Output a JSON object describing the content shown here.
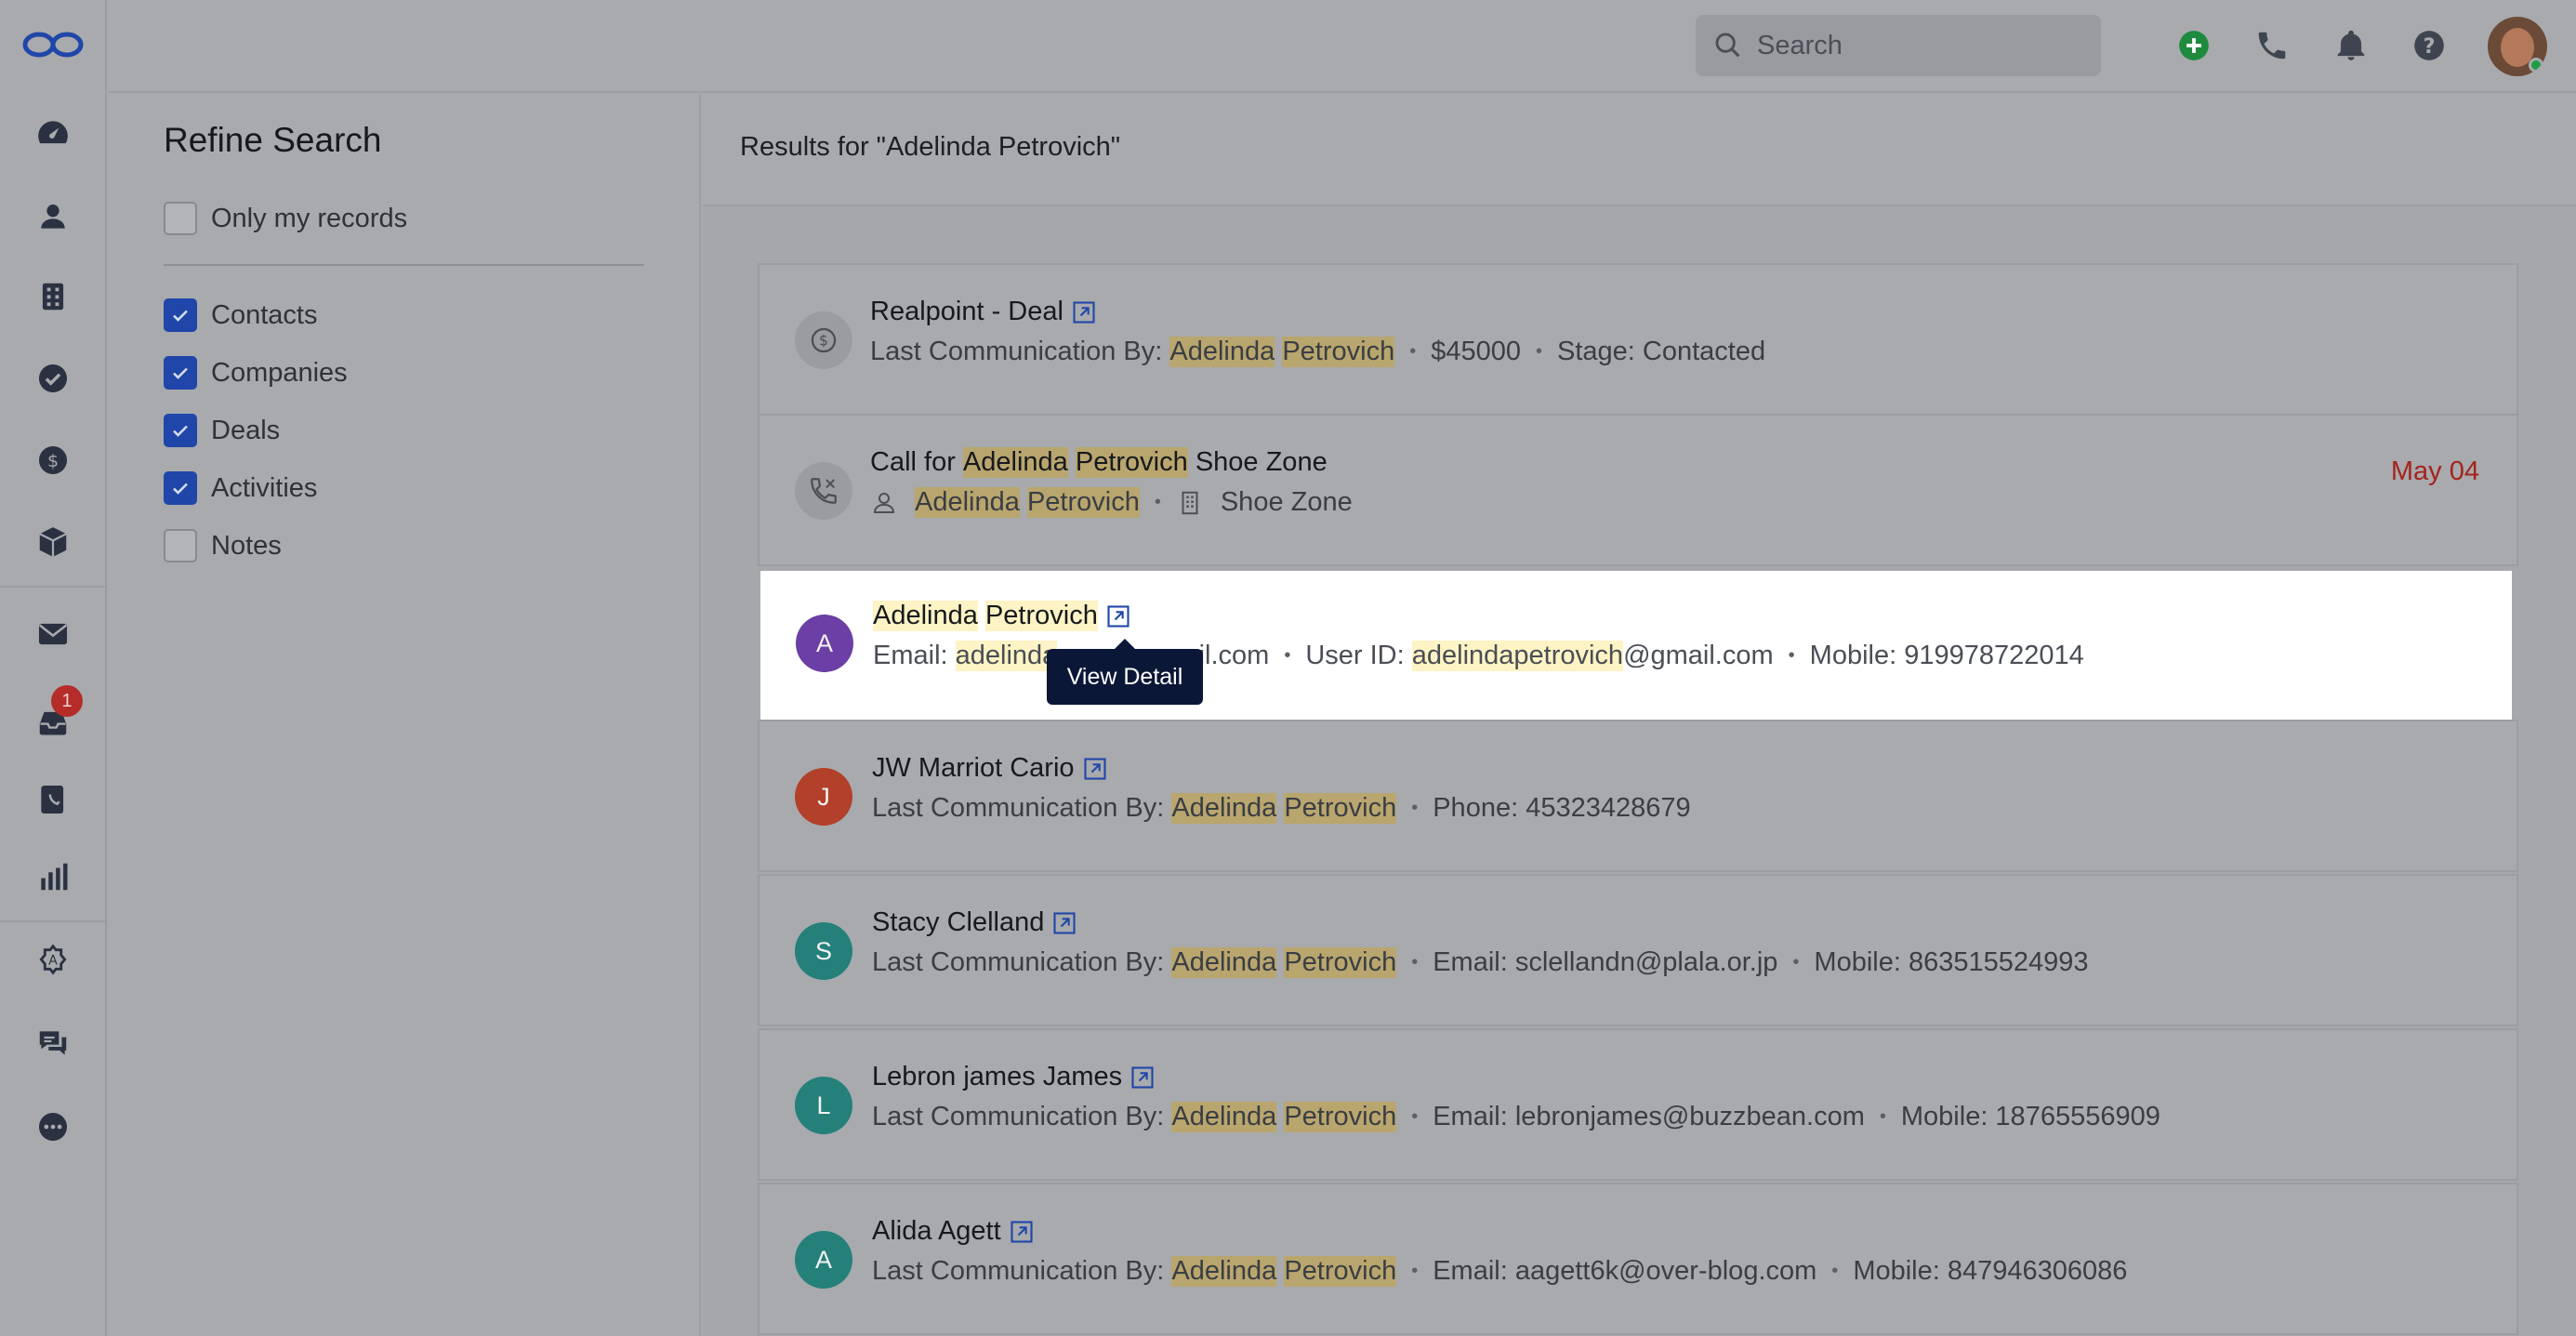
{
  "topbar": {
    "search_placeholder": "Search"
  },
  "rail": {
    "badge_count": "1"
  },
  "refine": {
    "title": "Refine Search",
    "only_mine": "Only my records",
    "filters": [
      {
        "label": "Contacts",
        "checked": true
      },
      {
        "label": "Companies",
        "checked": true
      },
      {
        "label": "Deals",
        "checked": true
      },
      {
        "label": "Activities",
        "checked": true
      },
      {
        "label": "Notes",
        "checked": false
      }
    ]
  },
  "results": {
    "heading": "Results for \"Adelinda Petrovich\"",
    "tooltip": "View Detail",
    "items": [
      {
        "title": "Realpoint - Deal",
        "last_comm_label": "Last Communication By:",
        "first": "Adelinda",
        "last": "Petrovich",
        "amount": "$45000",
        "stage": "Stage: Contacted"
      },
      {
        "title_prefix": "Call for",
        "first": "Adelinda",
        "last": "Petrovich",
        "title_suffix": "Shoe Zone",
        "company": "Shoe Zone",
        "date": "May 04"
      },
      {
        "initial": "A",
        "avatar_color": "#6b3fa5",
        "first": "Adelinda",
        "last": "Petrovich",
        "email_label": "Email:",
        "email_hl": "adelinda",
        "email_rest": "mail.com",
        "userid_label": "User ID:",
        "userid_hl": "adelindapetrovich",
        "userid_rest": "@gmail.com",
        "mobile": "Mobile: 919978722014"
      },
      {
        "initial": "J",
        "avatar_color": "#b2402a",
        "title": "JW Marriot Cario",
        "last_comm_label": "Last Communication By:",
        "first": "Adelinda",
        "last": "Petrovich",
        "extra1": "Phone: 45323428679"
      },
      {
        "initial": "S",
        "avatar_color": "#25807a",
        "title": "Stacy Clelland",
        "last_comm_label": "Last Communication By:",
        "first": "Adelinda",
        "last": "Petrovich",
        "extra1": "Email: sclellandn@plala.or.jp",
        "extra2": "Mobile: 863515524993"
      },
      {
        "initial": "L",
        "avatar_color": "#25807a",
        "title": "Lebron james James",
        "last_comm_label": "Last Communication By:",
        "first": "Adelinda",
        "last": "Petrovich",
        "extra1": "Email: lebronjames@buzzbean.com",
        "extra2": "Mobile: 18765556909"
      },
      {
        "initial": "A",
        "avatar_color": "#25807a",
        "title": "Alida Agett",
        "last_comm_label": "Last Communication By:",
        "first": "Adelinda",
        "last": "Petrovich",
        "extra1": "Email: aagett6k@over-blog.com",
        "extra2": "Mobile: 847946306086"
      }
    ]
  }
}
